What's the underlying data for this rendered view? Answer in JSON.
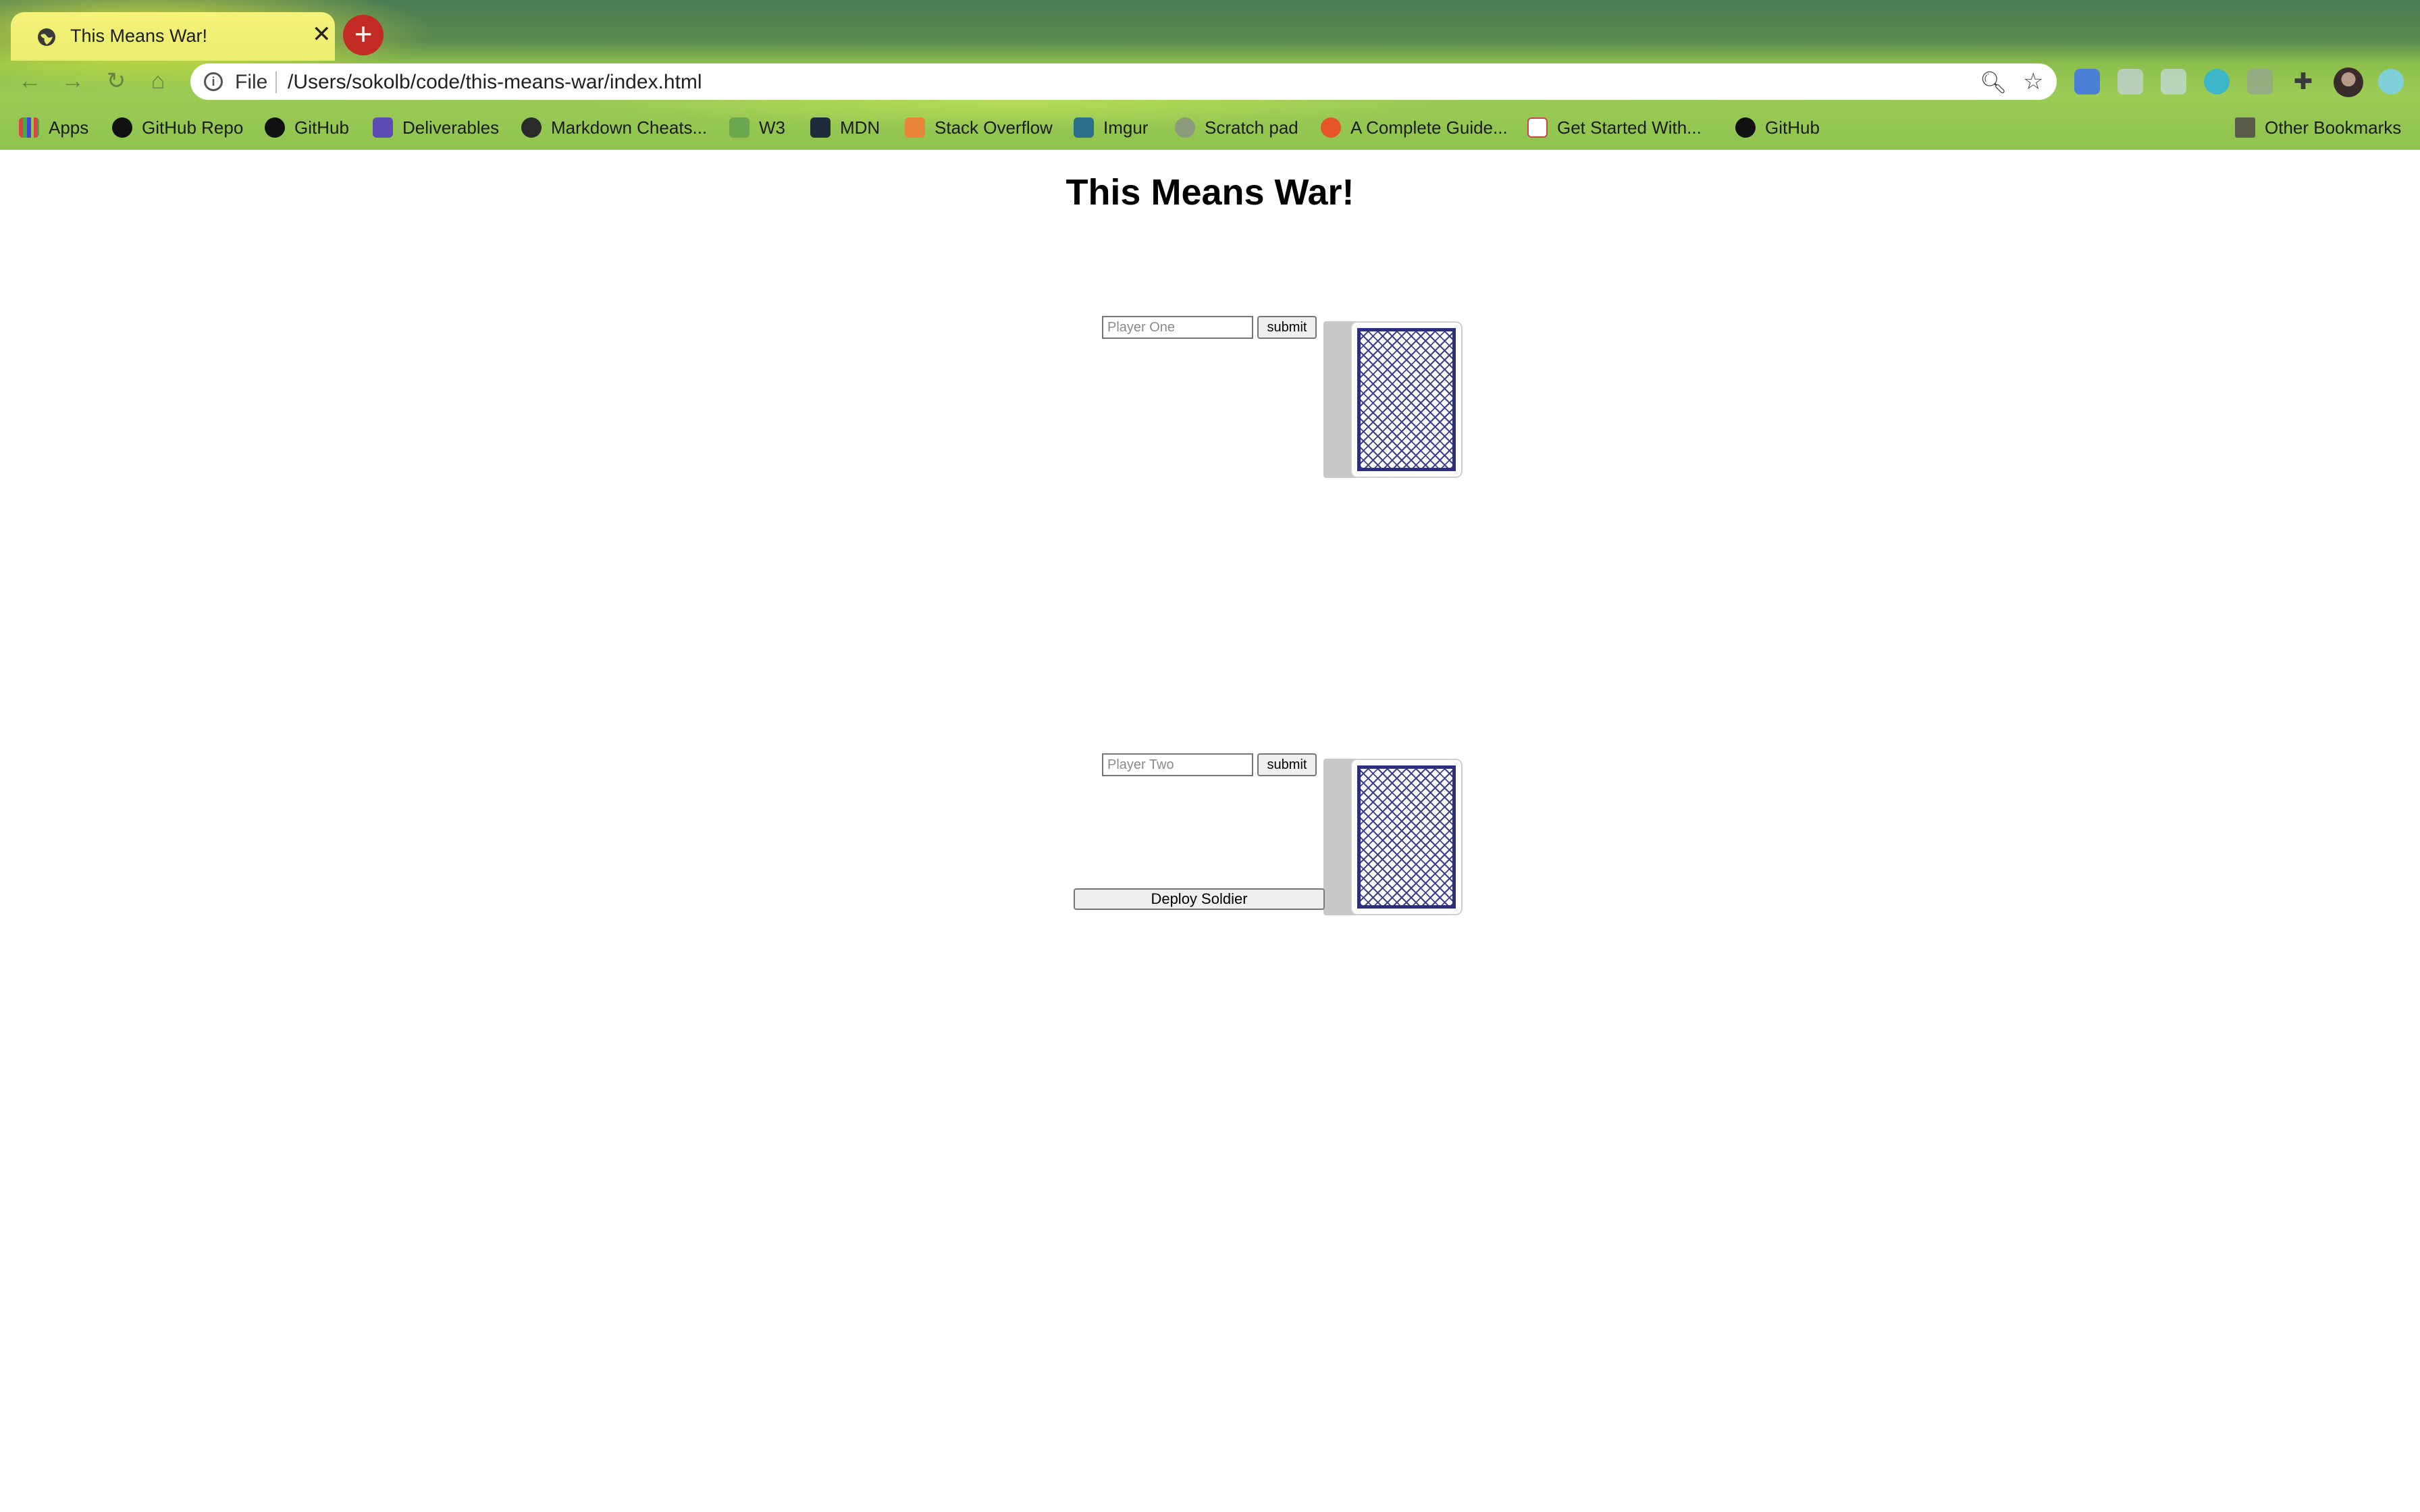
{
  "browser": {
    "tab": {
      "title": "This Means War!"
    },
    "address_bar": {
      "scheme": "File",
      "url": "/Users/sokolb/code/this-means-war/index.html"
    },
    "bookmarks": [
      {
        "label": "Apps",
        "icon": "apps-grid-icon"
      },
      {
        "label": "GitHub Repo",
        "icon": "github-icon"
      },
      {
        "label": "GitHub",
        "icon": "github-icon"
      },
      {
        "label": "Deliverables",
        "icon": "list-icon"
      },
      {
        "label": "Markdown Cheats...",
        "icon": "github-icon"
      },
      {
        "label": "W3",
        "icon": "w3-icon"
      },
      {
        "label": "MDN",
        "icon": "mdn-icon"
      },
      {
        "label": "Stack Overflow",
        "icon": "stackoverflow-icon"
      },
      {
        "label": "Imgur",
        "icon": "imgur-icon"
      },
      {
        "label": "Scratch pad",
        "icon": "scratchpad-icon"
      },
      {
        "label": "A Complete Guide...",
        "icon": "guide-icon"
      },
      {
        "label": "Get Started With...",
        "icon": "code-icon"
      },
      {
        "label": "GitHub",
        "icon": "github-icon"
      }
    ],
    "other_bookmarks": "Other Bookmarks"
  },
  "page": {
    "title": "This Means War!",
    "player_one": {
      "placeholder": "Player One",
      "value": "",
      "submit_label": "submit"
    },
    "player_two": {
      "placeholder": "Player Two",
      "value": "",
      "submit_label": "submit"
    },
    "deploy_label": "Deploy Soldier"
  },
  "colors": {
    "card_back": "#2b2f7e",
    "deck_stack": "#c8c8c8",
    "new_tab_button": "#c42a24"
  }
}
